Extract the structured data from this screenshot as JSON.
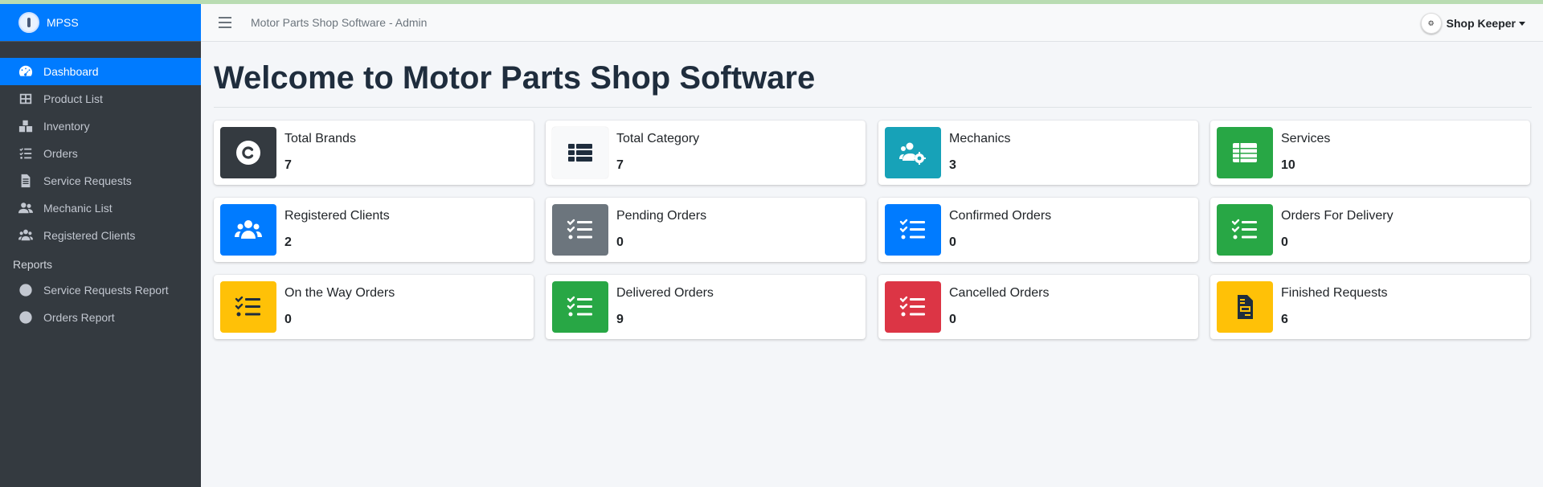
{
  "brand": {
    "name": "MPSS"
  },
  "navbar": {
    "title": "Motor Parts Shop Software - Admin",
    "user_name": "Shop Keeper"
  },
  "sidebar": {
    "items": [
      {
        "label": "Dashboard",
        "icon": "tachometer-icon",
        "active": true
      },
      {
        "label": "Product List",
        "icon": "table-icon"
      },
      {
        "label": "Inventory",
        "icon": "boxes-icon"
      },
      {
        "label": "Orders",
        "icon": "tasks-icon"
      },
      {
        "label": "Service Requests",
        "icon": "file-icon"
      },
      {
        "label": "Mechanic List",
        "icon": "users-icon"
      },
      {
        "label": "Registered Clients",
        "icon": "users-icon"
      }
    ],
    "reports_header": "Reports",
    "report_items": [
      {
        "label": "Service Requests Report",
        "icon": "circle-icon"
      },
      {
        "label": "Orders Report",
        "icon": "circle-icon"
      }
    ]
  },
  "page": {
    "title": "Welcome to Motor Parts Shop Software"
  },
  "boxes": [
    {
      "label": "Total Brands",
      "value": "7",
      "icon": "copyright-icon",
      "color": "#343a40"
    },
    {
      "label": "Total Category",
      "value": "7",
      "icon": "th-list-icon",
      "color": "#f8f9fa"
    },
    {
      "label": "Mechanics",
      "value": "3",
      "icon": "users-cog-icon",
      "color": "#17a2b8"
    },
    {
      "label": "Services",
      "value": "10",
      "icon": "th-list-icon",
      "color": "#28a745"
    },
    {
      "label": "Registered Clients",
      "value": "2",
      "icon": "users-icon",
      "color": "#007bff"
    },
    {
      "label": "Pending Orders",
      "value": "0",
      "icon": "tasks-icon",
      "color": "#6c757d"
    },
    {
      "label": "Confirmed Orders",
      "value": "0",
      "icon": "tasks-icon",
      "color": "#007bff"
    },
    {
      "label": "Orders For Delivery",
      "value": "0",
      "icon": "tasks-icon",
      "color": "#28a745"
    },
    {
      "label": "On the Way Orders",
      "value": "0",
      "icon": "tasks-icon",
      "color": "#ffc107"
    },
    {
      "label": "Delivered Orders",
      "value": "9",
      "icon": "tasks-icon",
      "color": "#28a745"
    },
    {
      "label": "Cancelled Orders",
      "value": "0",
      "icon": "tasks-icon",
      "color": "#dc3545"
    },
    {
      "label": "Finished Requests",
      "value": "6",
      "icon": "file-invoice-icon",
      "color": "#ffc107"
    }
  ]
}
